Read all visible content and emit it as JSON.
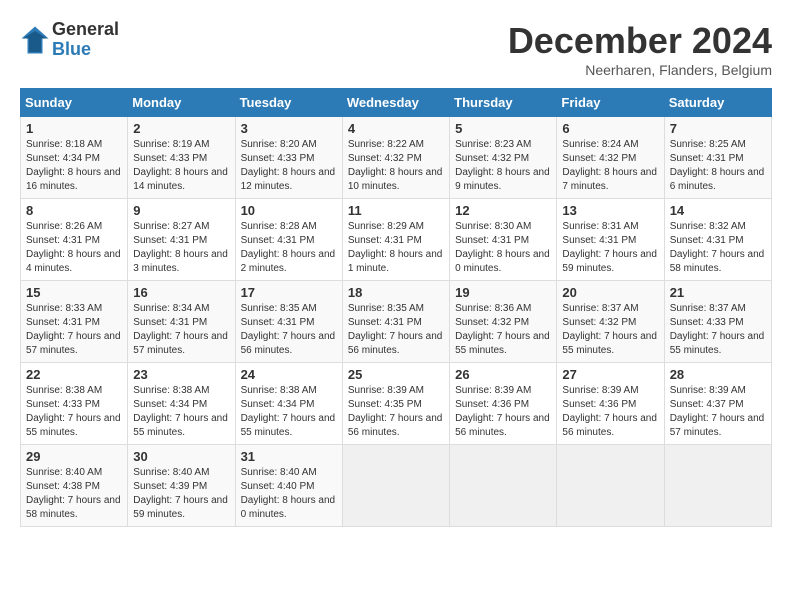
{
  "logo": {
    "general": "General",
    "blue": "Blue"
  },
  "title": "December 2024",
  "subtitle": "Neerharen, Flanders, Belgium",
  "days_header": [
    "Sunday",
    "Monday",
    "Tuesday",
    "Wednesday",
    "Thursday",
    "Friday",
    "Saturday"
  ],
  "weeks": [
    [
      {
        "day": "1",
        "sunrise": "8:18 AM",
        "sunset": "4:34 PM",
        "daylight": "8 hours and 16 minutes."
      },
      {
        "day": "2",
        "sunrise": "8:19 AM",
        "sunset": "4:33 PM",
        "daylight": "8 hours and 14 minutes."
      },
      {
        "day": "3",
        "sunrise": "8:20 AM",
        "sunset": "4:33 PM",
        "daylight": "8 hours and 12 minutes."
      },
      {
        "day": "4",
        "sunrise": "8:22 AM",
        "sunset": "4:32 PM",
        "daylight": "8 hours and 10 minutes."
      },
      {
        "day": "5",
        "sunrise": "8:23 AM",
        "sunset": "4:32 PM",
        "daylight": "8 hours and 9 minutes."
      },
      {
        "day": "6",
        "sunrise": "8:24 AM",
        "sunset": "4:32 PM",
        "daylight": "8 hours and 7 minutes."
      },
      {
        "day": "7",
        "sunrise": "8:25 AM",
        "sunset": "4:31 PM",
        "daylight": "8 hours and 6 minutes."
      }
    ],
    [
      {
        "day": "8",
        "sunrise": "8:26 AM",
        "sunset": "4:31 PM",
        "daylight": "8 hours and 4 minutes."
      },
      {
        "day": "9",
        "sunrise": "8:27 AM",
        "sunset": "4:31 PM",
        "daylight": "8 hours and 3 minutes."
      },
      {
        "day": "10",
        "sunrise": "8:28 AM",
        "sunset": "4:31 PM",
        "daylight": "8 hours and 2 minutes."
      },
      {
        "day": "11",
        "sunrise": "8:29 AM",
        "sunset": "4:31 PM",
        "daylight": "8 hours and 1 minute."
      },
      {
        "day": "12",
        "sunrise": "8:30 AM",
        "sunset": "4:31 PM",
        "daylight": "8 hours and 0 minutes."
      },
      {
        "day": "13",
        "sunrise": "8:31 AM",
        "sunset": "4:31 PM",
        "daylight": "7 hours and 59 minutes."
      },
      {
        "day": "14",
        "sunrise": "8:32 AM",
        "sunset": "4:31 PM",
        "daylight": "7 hours and 58 minutes."
      }
    ],
    [
      {
        "day": "15",
        "sunrise": "8:33 AM",
        "sunset": "4:31 PM",
        "daylight": "7 hours and 57 minutes."
      },
      {
        "day": "16",
        "sunrise": "8:34 AM",
        "sunset": "4:31 PM",
        "daylight": "7 hours and 57 minutes."
      },
      {
        "day": "17",
        "sunrise": "8:35 AM",
        "sunset": "4:31 PM",
        "daylight": "7 hours and 56 minutes."
      },
      {
        "day": "18",
        "sunrise": "8:35 AM",
        "sunset": "4:31 PM",
        "daylight": "7 hours and 56 minutes."
      },
      {
        "day": "19",
        "sunrise": "8:36 AM",
        "sunset": "4:32 PM",
        "daylight": "7 hours and 55 minutes."
      },
      {
        "day": "20",
        "sunrise": "8:37 AM",
        "sunset": "4:32 PM",
        "daylight": "7 hours and 55 minutes."
      },
      {
        "day": "21",
        "sunrise": "8:37 AM",
        "sunset": "4:33 PM",
        "daylight": "7 hours and 55 minutes."
      }
    ],
    [
      {
        "day": "22",
        "sunrise": "8:38 AM",
        "sunset": "4:33 PM",
        "daylight": "7 hours and 55 minutes."
      },
      {
        "day": "23",
        "sunrise": "8:38 AM",
        "sunset": "4:34 PM",
        "daylight": "7 hours and 55 minutes."
      },
      {
        "day": "24",
        "sunrise": "8:38 AM",
        "sunset": "4:34 PM",
        "daylight": "7 hours and 55 minutes."
      },
      {
        "day": "25",
        "sunrise": "8:39 AM",
        "sunset": "4:35 PM",
        "daylight": "7 hours and 56 minutes."
      },
      {
        "day": "26",
        "sunrise": "8:39 AM",
        "sunset": "4:36 PM",
        "daylight": "7 hours and 56 minutes."
      },
      {
        "day": "27",
        "sunrise": "8:39 AM",
        "sunset": "4:36 PM",
        "daylight": "7 hours and 56 minutes."
      },
      {
        "day": "28",
        "sunrise": "8:39 AM",
        "sunset": "4:37 PM",
        "daylight": "7 hours and 57 minutes."
      }
    ],
    [
      {
        "day": "29",
        "sunrise": "8:40 AM",
        "sunset": "4:38 PM",
        "daylight": "7 hours and 58 minutes."
      },
      {
        "day": "30",
        "sunrise": "8:40 AM",
        "sunset": "4:39 PM",
        "daylight": "7 hours and 59 minutes."
      },
      {
        "day": "31",
        "sunrise": "8:40 AM",
        "sunset": "4:40 PM",
        "daylight": "8 hours and 0 minutes."
      },
      null,
      null,
      null,
      null
    ]
  ]
}
